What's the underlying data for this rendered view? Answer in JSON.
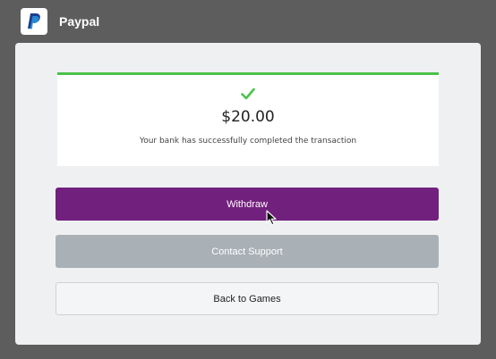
{
  "header": {
    "title": "Paypal",
    "logo_icon": "paypal-logo-icon"
  },
  "transaction": {
    "status_icon": "check-icon",
    "status_color": "#4cc24c",
    "amount": "$20.00",
    "message": "Your bank has successfully completed the transaction"
  },
  "actions": {
    "withdraw_label": "Withdraw",
    "contact_support_label": "Contact Support",
    "back_label": "Back to Games"
  },
  "colors": {
    "accent": "#72207d",
    "disabled": "#a9b0b6",
    "success": "#4cc24c"
  }
}
